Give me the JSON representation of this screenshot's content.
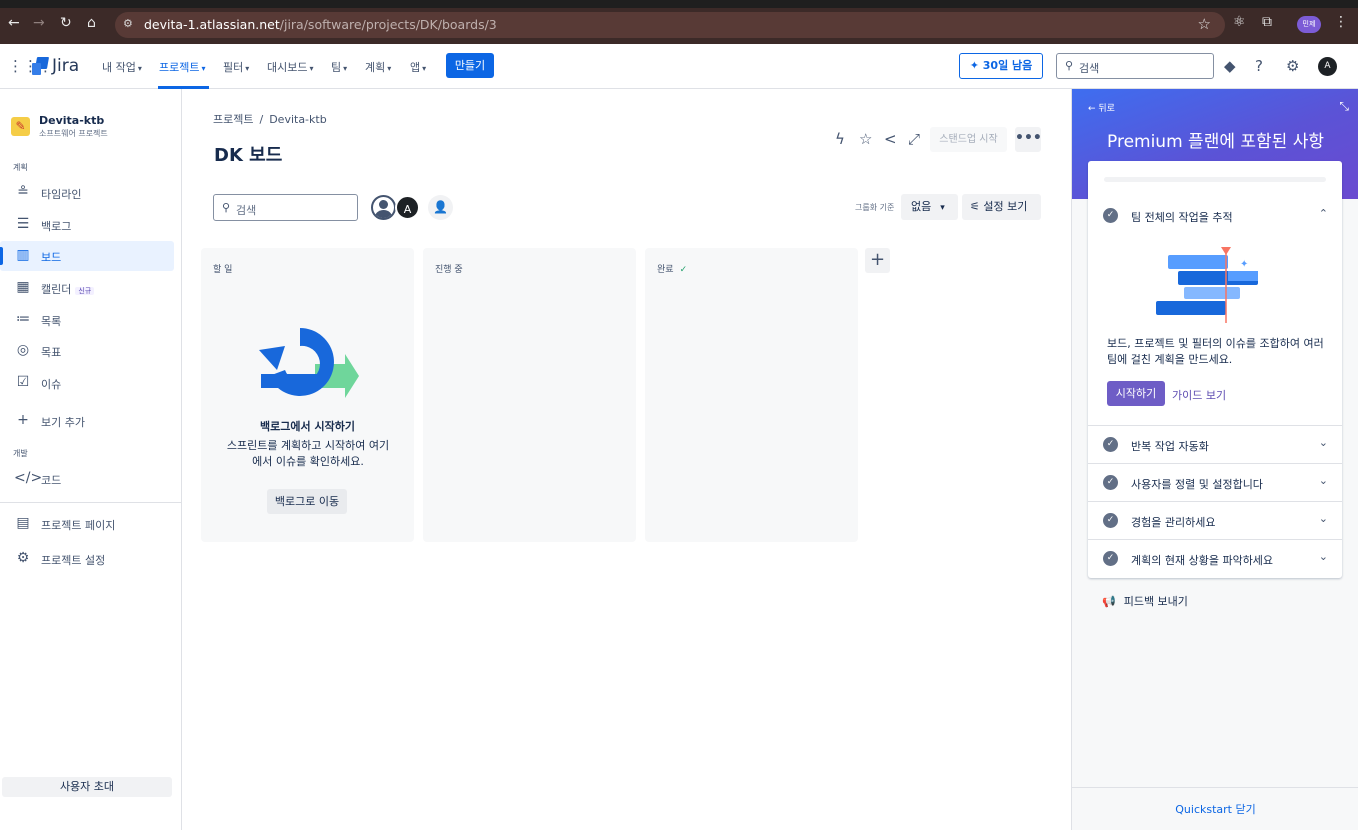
{
  "browser": {
    "url_host": "devita-1.atlassian.net",
    "url_path": "/jira/software/projects/DK/boards/3",
    "profile_label": "민제"
  },
  "topnav": {
    "logo": "Jira",
    "menus": [
      "내 작업",
      "프로젝트",
      "필터",
      "대시보드",
      "팀",
      "계획",
      "앱"
    ],
    "create": "만들기",
    "trial": "30일 남음",
    "search_placeholder": "검색",
    "avatar": "A"
  },
  "sidebar": {
    "project_name": "Devita-ktb",
    "project_type": "소프트웨어 프로젝트",
    "plan_section": "계획",
    "items": [
      "타임라인",
      "백로그",
      "보드",
      "캘린더",
      "목록",
      "목표",
      "이슈"
    ],
    "new_badge": "신규",
    "add_view": "보기 추가",
    "dev_section": "개발",
    "code": "코드",
    "project_page": "프로젝트 페이지",
    "project_settings": "프로젝트 설정",
    "invite": "사용자 초대"
  },
  "main": {
    "breadcrumb_root": "프로젝트",
    "breadcrumb_current": "Devita-ktb",
    "title": "DK 보드",
    "standup": "스탠드업 시작",
    "search_placeholder": "검색",
    "avatar_letter": "A",
    "group_by_label": "그룹화 기준",
    "group_by_value": "없음",
    "view_settings": "설정 보기",
    "columns": [
      "할 일",
      "진행 중",
      "완료"
    ],
    "empty_title": "백로그에서 시작하기",
    "empty_desc": "스프린트를 계획하고 시작하여 여기에서 이슈를 확인하세요.",
    "backlog_button": "백로그로 이동"
  },
  "panel": {
    "back": "뒤로",
    "title": "Premium 플랜에 포함된 사항",
    "sections": [
      "팀 전체의 작업을 추적",
      "반복 작업 자동화",
      "사용자를 정렬 및 설정합니다",
      "경험을 관리하세요",
      "계획의 현재 상황을 파악하세요"
    ],
    "desc": "보드, 프로젝트 및 필터의 이슈를 조합하여 여러 팀에 걸친 계획을 만드세요.",
    "start": "시작하기",
    "guide": "가이드 보기",
    "feedback": "피드백 보내기",
    "close": "Quickstart 닫기"
  },
  "colors": {
    "accent": "#0c66e4",
    "premium_gradient_start": "#3e6ef0",
    "premium_gradient_end": "#6a4ad0",
    "start_button": "#6e5dc6"
  }
}
